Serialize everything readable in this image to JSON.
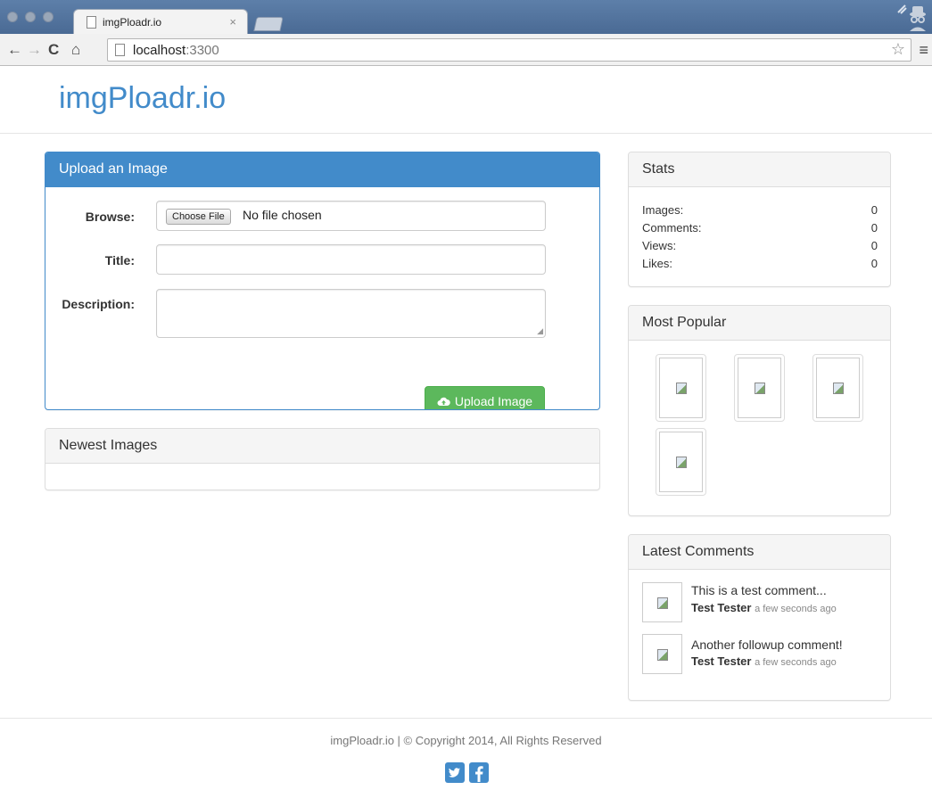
{
  "browser": {
    "tab_title": "imgPloadr.io",
    "tab_close": "×",
    "url_host": "localhost",
    "url_port": ":3300",
    "back": "←",
    "forward": "→",
    "reload": "C",
    "home": "⌂",
    "star": "☆",
    "menu": "≡"
  },
  "site": {
    "brand": "imgPloadr.io"
  },
  "upload": {
    "heading": "Upload an Image",
    "browse_label": "Browse:",
    "choose_file": "Choose File",
    "no_file": "No file chosen",
    "title_label": "Title:",
    "title_value": "",
    "description_label": "Description:",
    "description_value": "",
    "submit": "Upload Image"
  },
  "newest": {
    "heading": "Newest Images"
  },
  "stats": {
    "heading": "Stats",
    "rows": [
      {
        "label": "Images:",
        "value": "0"
      },
      {
        "label": "Comments:",
        "value": "0"
      },
      {
        "label": "Views:",
        "value": "0"
      },
      {
        "label": "Likes:",
        "value": "0"
      }
    ]
  },
  "popular": {
    "heading": "Most Popular",
    "thumb_count": 4
  },
  "comments": {
    "heading": "Latest Comments",
    "items": [
      {
        "text": "This is a test comment...",
        "author": "Test Tester",
        "time": "a few seconds ago"
      },
      {
        "text": "Another followup comment!",
        "author": "Test Tester",
        "time": "a few seconds ago"
      }
    ]
  },
  "footer": {
    "text": "imgPloadr.io | © Copyright 2014, All Rights Reserved"
  },
  "colors": {
    "primary": "#428bca",
    "success": "#5cb85c",
    "social": "#428bca"
  }
}
